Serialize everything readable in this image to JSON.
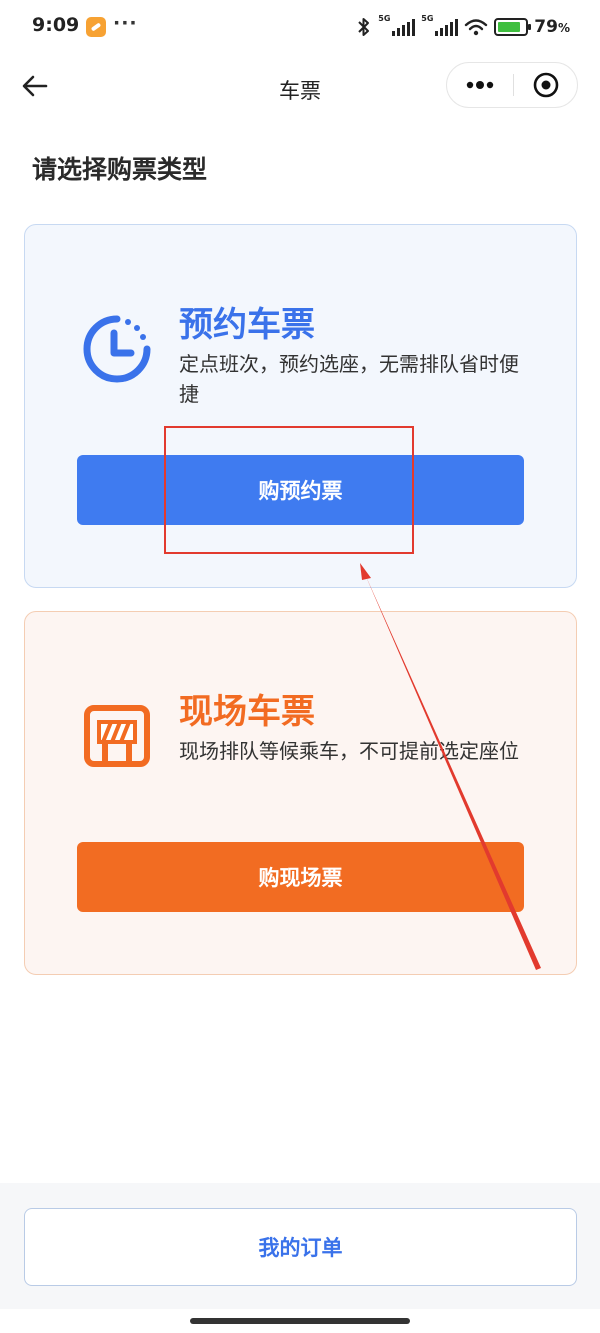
{
  "status_bar": {
    "time": "9:09",
    "dots": "···",
    "net1": "5G",
    "net2": "5G",
    "battery": "79",
    "battery_unit": "%"
  },
  "nav": {
    "title": "车票"
  },
  "page": {
    "heading": "请选择购票类型"
  },
  "cards": [
    {
      "title": "预约车票",
      "description": "定点班次，预约选座，无需排队省时便捷",
      "button": "购预约票",
      "accent": "#3f7bf0",
      "icon": "clock-icon"
    },
    {
      "title": "现场车票",
      "description": "现场排队等候乘车，不可提前选定座位",
      "button": "购现场票",
      "accent": "#f26c22",
      "icon": "barrier-icon"
    }
  ],
  "footer": {
    "orders_button": "我的订单"
  },
  "annotation": {
    "highlight_color": "#e23a2e"
  }
}
